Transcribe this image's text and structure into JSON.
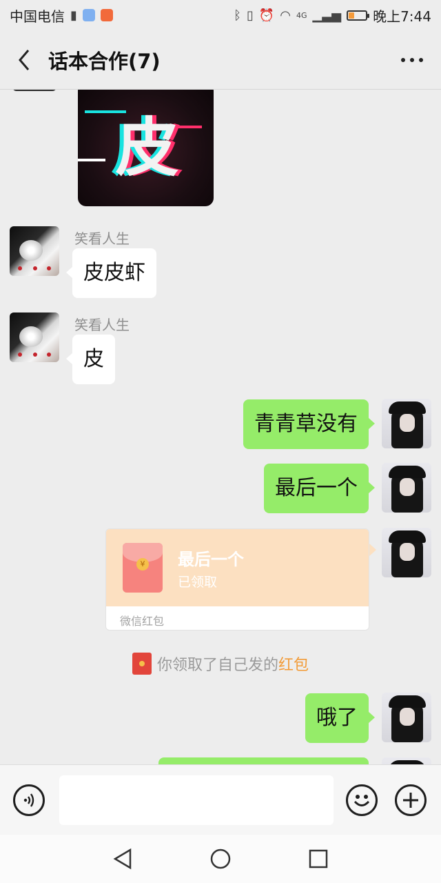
{
  "status_bar": {
    "carrier": "中国电信",
    "network": "4G",
    "time": "晚上7:44",
    "battery_level": 0.3,
    "battery_color": "#f49a3a"
  },
  "header": {
    "title": "话本合作(7)",
    "back_icon": "chevron-left-icon",
    "more_icon": "more-dots-icon"
  },
  "messages": [
    {
      "type": "sticker",
      "direction": "in",
      "sticker_text": "皮"
    },
    {
      "type": "text",
      "direction": "in",
      "sender": "笑看人生",
      "text": "皮皮虾"
    },
    {
      "type": "text",
      "direction": "in",
      "sender": "笑看人生",
      "text": "皮"
    },
    {
      "type": "text",
      "direction": "out",
      "text": "青青草没有"
    },
    {
      "type": "text",
      "direction": "out",
      "text": "最后一个"
    },
    {
      "type": "red_packet",
      "direction": "out",
      "title": "最后一个",
      "status": "已领取",
      "footer": "微信红包"
    },
    {
      "type": "system",
      "text": "你领取了自己发的",
      "link_text": "红包"
    },
    {
      "type": "text",
      "direction": "out",
      "text": "哦了"
    }
  ],
  "input_bar": {
    "voice_icon": "voice-icon",
    "emoji_icon": "emoji-icon",
    "plus_icon": "plus-icon",
    "text_value": ""
  },
  "nav_bar": {
    "back_icon": "triangle-back-icon",
    "home_icon": "circle-home-icon",
    "recents_icon": "square-recents-icon"
  },
  "colors": {
    "outgoing_bubble": "#95ec69",
    "incoming_bubble": "#ffffff",
    "red_packet": "#fce0c1",
    "link": "#f29b38"
  }
}
